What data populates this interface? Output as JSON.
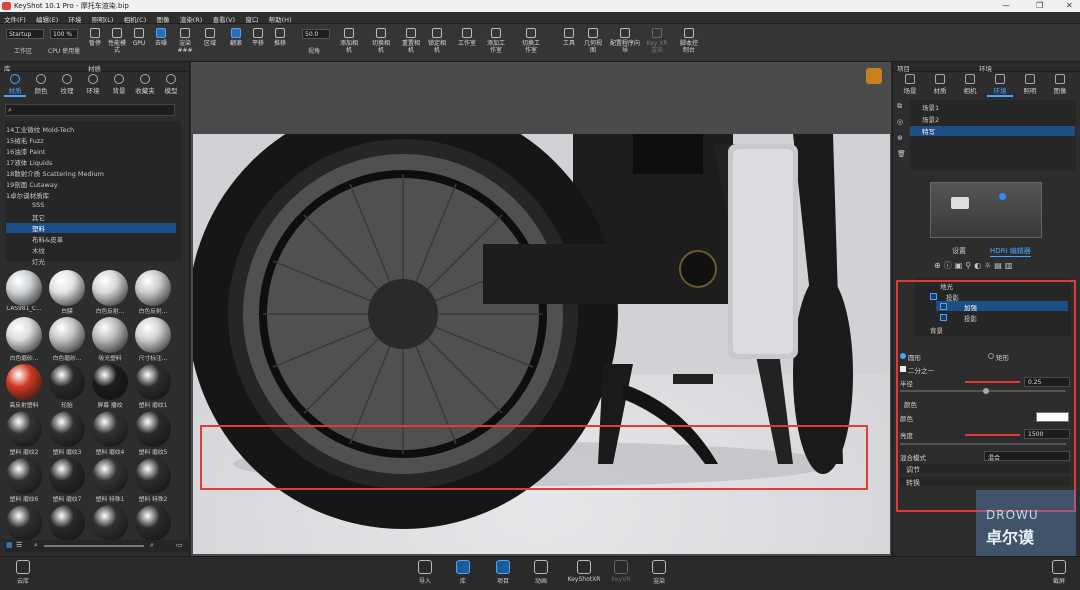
{
  "window": {
    "title": "KeyShot 10.1 Pro  -  摩托车渲染.bip"
  },
  "menu": [
    "文件(F)",
    "编辑(E)",
    "环境",
    "照明(L)",
    "相机(C)",
    "图像",
    "渲染(R)",
    "查看(V)",
    "窗口",
    "帮助(H)"
  ],
  "toolbar": {
    "preset": "Startup",
    "zoom": "100 %",
    "fov": "50.0",
    "workspace": "工作区",
    "cpu": "CPU 使用量",
    "pause": "暂停",
    "perf": "性能模式",
    "gpu": "GPU",
    "denoise": "去噪",
    "realtime": "渲染 ###",
    "region": "区域",
    "tumble": "翻滚",
    "pan": "平移",
    "dolly": "推移",
    "perspective": "视角",
    "add_camera": "添加相机",
    "switch_camera": "切换相机",
    "reset_camera": "重置相机",
    "lock_camera": "锁定相机",
    "studio": "工作室",
    "add_studio": "添加工作室",
    "switch_studio": "切换工作室",
    "tools": "工具",
    "geometry": "几何视图",
    "config": "配置程序向导",
    "keyxr": "Key XR 渲染",
    "script": "脚本控制台"
  },
  "library": {
    "header": "库",
    "title": "材质",
    "tabs": [
      "材质",
      "颜色",
      "纹理",
      "环境",
      "背景",
      "收藏夹",
      "模型"
    ],
    "tree": [
      "14工业微纹 Mold-Tech",
      "15绒毛 Fuzz",
      "16油漆 Paint",
      "17液体 Liquids",
      "18散射介质 Scattering Medium",
      "19剖面 Cutaway",
      "1卓尔谟材质库",
      "SSS",
      "其它",
      "塑料",
      "布料&皮革",
      "木纹",
      "灯光"
    ],
    "selected_index": 9,
    "swatches": [
      {
        "label": "CAS981_C...",
        "color": "#cfd3d6"
      },
      {
        "label": "白膜",
        "color": "#e3e3e3"
      },
      {
        "label": "白色反射...",
        "color": "#d7d7d7"
      },
      {
        "label": "白色反射...",
        "color": "#cdcdcd"
      },
      {
        "label": "白色磨砂...",
        "color": "#dcdcdc"
      },
      {
        "label": "白色磨砂...",
        "color": "#c7c7c7"
      },
      {
        "label": "吸光塑料",
        "color": "#bdbdbd"
      },
      {
        "label": "尺寸标注...",
        "color": "#d1d1d1"
      },
      {
        "label": "高反射塑料",
        "color": "#d23a22"
      },
      {
        "label": "轮胎",
        "color": "#2a2a2a"
      },
      {
        "label": "屏幕 播纹",
        "color": "#1c1c1c"
      },
      {
        "label": "塑料 磨纹1",
        "color": "#2c2c2c"
      },
      {
        "label": "塑料 磨纹2",
        "color": "#333333"
      },
      {
        "label": "塑料 磨纹3",
        "color": "#2e2e2e"
      },
      {
        "label": "塑料 磨纹4",
        "color": "#313131"
      },
      {
        "label": "塑料 磨纹5",
        "color": "#2b2b2b"
      },
      {
        "label": "塑料 磨纹6",
        "color": "#303030"
      },
      {
        "label": "塑料 磨纹7",
        "color": "#292929"
      },
      {
        "label": "塑料 特殊1",
        "color": "#343434"
      },
      {
        "label": "塑料 特殊2",
        "color": "#2d2d2d"
      },
      {
        "label": "",
        "color": "#2f2f2f"
      },
      {
        "label": "",
        "color": "#2a2a2a"
      },
      {
        "label": "",
        "color": "#303030"
      },
      {
        "label": "",
        "color": "#2c2c2c"
      }
    ]
  },
  "project": {
    "header": "项目",
    "title": "环境",
    "tabs": [
      "场景",
      "材质",
      "相机",
      "环境",
      "照明",
      "图像"
    ],
    "environments": [
      "场景1",
      "场景2",
      "特写"
    ],
    "selected_env": "特写",
    "subtabs": {
      "settings": "设置",
      "hdri": "HDRI 编辑器"
    },
    "layers": {
      "item1": "地光",
      "group": "投影",
      "pin1": "加强",
      "pin2": "投影",
      "bg": "背景"
    },
    "shape_circle": "圆形",
    "shape_rect": "矩形",
    "half": "二分之一",
    "radius_label": "半径",
    "radius_value": "0.25",
    "color_section": "颜色",
    "color_label": "颜色",
    "brightness_label": "亮度",
    "brightness_value": "1500",
    "blend_label": "混合模式",
    "blend_value": "混合",
    "adjust": "调节",
    "transform": "转换",
    "accent": "#4aa3ff",
    "highlight": "#e53935"
  },
  "bottom": {
    "cloud": "云库",
    "import": "导入",
    "library": "库",
    "project": "项目",
    "animation": "动画",
    "xr": "KeyShotXR",
    "keyvr": "KeyVR",
    "render": "渲染",
    "fullscreen": "截屏"
  },
  "watermark": {
    "top": "DROWU",
    "bottom": "卓尔谟"
  }
}
